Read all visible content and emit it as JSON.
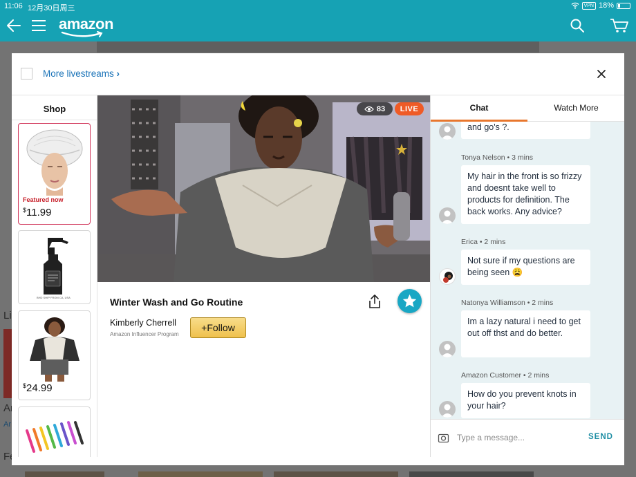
{
  "status": {
    "time": "11:06",
    "date": "12月30日周三",
    "vpn": "VPN",
    "battery": "18%"
  },
  "header": {
    "logo": "amazon"
  },
  "background": {
    "fragment_li": "Li",
    "fragment_ar": "Ar",
    "fragment_link": "Ar",
    "fragment_fe": "Fe"
  },
  "modal": {
    "more_livestreams": "More livestreams"
  },
  "shop": {
    "title": "Shop",
    "items": [
      {
        "badge": "Featured now",
        "currency": "$",
        "price": "11.99"
      },
      {
        "label": "BHD SHIP FROM CA, USA"
      },
      {
        "currency": "$",
        "price": "24.99"
      },
      {}
    ]
  },
  "video": {
    "viewers": "83",
    "live_label": "LIVE"
  },
  "stream": {
    "title": "Winter Wash and Go Routine",
    "creator": "Kimberly Cherrell",
    "program": "Amazon Influencer Program",
    "follow_label": "+Follow"
  },
  "chat": {
    "tabs": [
      "Chat",
      "Watch More"
    ],
    "messages": [
      {
        "sender": "",
        "text": "and go's ?."
      },
      {
        "sender": "Tonya Nelson • 3 mins",
        "text": "My hair in the front is so frizzy and doesnt take well to products for definition. The back works. Any advice?"
      },
      {
        "sender": "Erica • 2 mins",
        "text": "Not sure if my questions are being seen 😩"
      },
      {
        "sender": "Natonya Williamson • 2 mins",
        "text": "Im a lazy natural i need to get out off thst and do better."
      },
      {
        "sender": "Amazon Customer • 2 mins",
        "text": "How do you prevent knots in your hair?"
      }
    ],
    "placeholder": "Type a message...",
    "send_label": "SEND"
  },
  "colors": {
    "header": "#16a2b4",
    "live": "#ef5b26",
    "tab_underline": "#e8772e",
    "featured_border": "#d1355a",
    "link": "#1a73b8"
  },
  "icons": [
    "back-arrow-icon",
    "hamburger-menu-icon",
    "search-icon",
    "cart-icon",
    "close-icon",
    "eye-icon",
    "share-icon",
    "star-icon",
    "camera-icon",
    "wifi-icon",
    "battery-icon"
  ]
}
